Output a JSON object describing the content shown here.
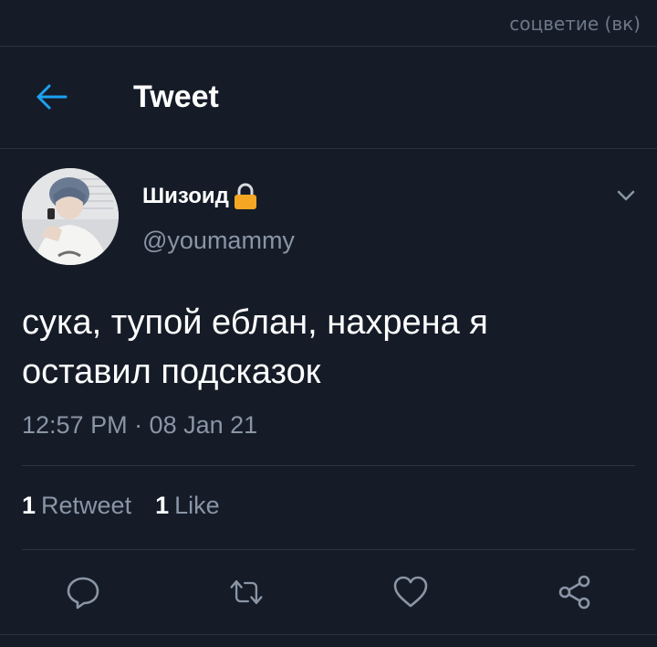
{
  "watermark": "соцветие (вк)",
  "header": {
    "title": "Tweet",
    "back_icon": "arrow-left-icon"
  },
  "tweet": {
    "display_name": "Шизоид",
    "lock_icon": "lock-icon",
    "username": "@youmammy",
    "text_lines": [
      "сука, тупой еблан, нахрена я",
      "оставил подсказок"
    ],
    "timestamp": "12:57 PM · 08 Jan 21",
    "stats": {
      "retweets_count": "1",
      "retweets_label": "Retweet",
      "likes_count": "1",
      "likes_label": "Like"
    }
  },
  "actions": [
    "reply-icon",
    "retweet-icon",
    "like-icon",
    "share-icon"
  ],
  "colors": {
    "background": "#151c28",
    "accent": "#1da1f2",
    "secondary_text": "#8a95a5",
    "lock": "#f5a623"
  }
}
